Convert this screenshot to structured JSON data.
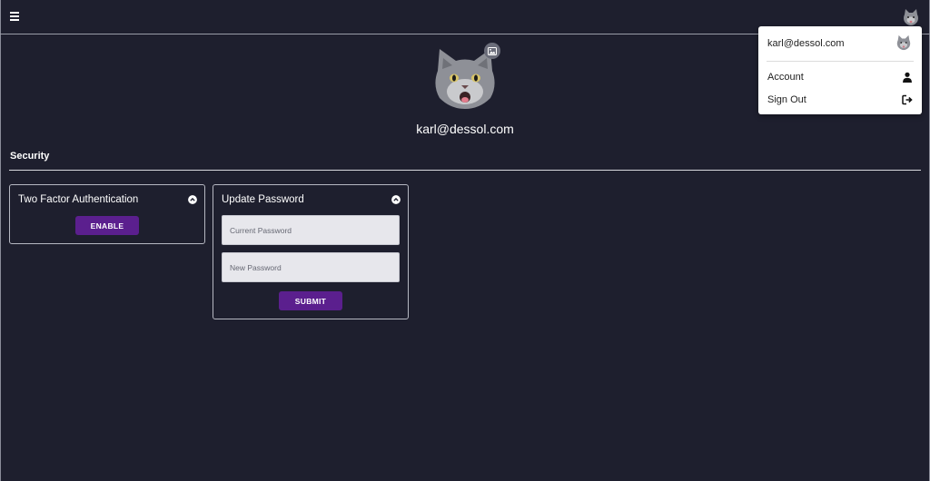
{
  "header": {
    "menu_icon": "hamburger-menu-icon",
    "avatar_icon": "cat-avatar-icon"
  },
  "profile": {
    "email": "karl@dessol.com",
    "change_photo_icon": "image-icon"
  },
  "security": {
    "title": "Security",
    "two_factor": {
      "title": "Two Factor Authentication",
      "enable_label": "ENABLE"
    },
    "update_password": {
      "title": "Update Password",
      "current_placeholder": "Current Password",
      "new_placeholder": "New Password",
      "submit_label": "SUBMIT"
    }
  },
  "user_menu": {
    "email": "karl@dessol.com",
    "items": [
      {
        "label": "Account",
        "icon": "user-icon"
      },
      {
        "label": "Sign Out",
        "icon": "sign-out-icon"
      }
    ]
  },
  "colors": {
    "background": "#1e1f2e",
    "accent": "#5b1f8e",
    "input_bg": "#e7e7ec"
  }
}
